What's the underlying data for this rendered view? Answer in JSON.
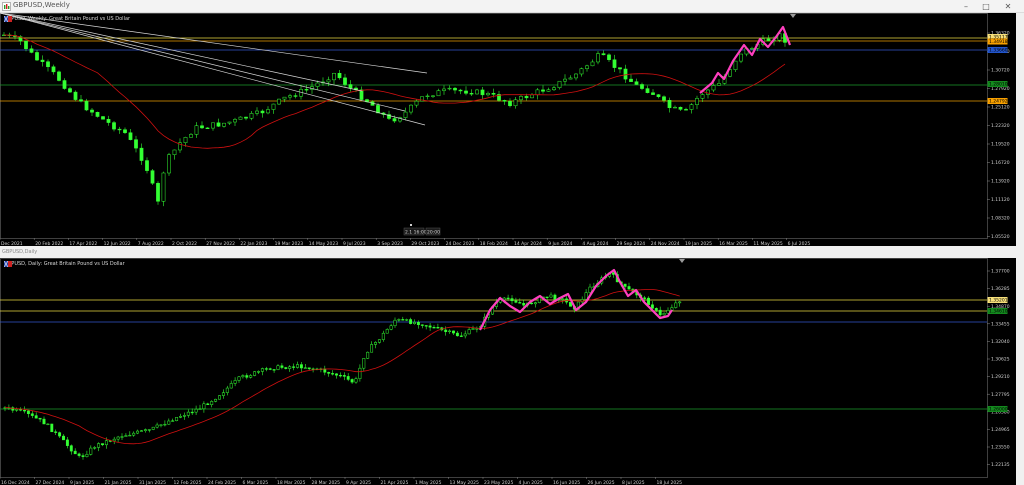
{
  "window": {
    "title": "GBPUSD,Weekly",
    "minimize": "–",
    "maximize": "□",
    "close": "✕"
  },
  "weekly": {
    "header": "GBPUSD, Weekly:  Great Britain Pound vs US Dollar",
    "price_labels": [
      "1.36320",
      "1.33570",
      "1.30720",
      "1.27920",
      "1.25120",
      "1.22320",
      "1.19520",
      "1.16720",
      "1.13920",
      "1.11120",
      "1.08320",
      "1.05520"
    ],
    "tags": [
      {
        "text": "1.35117",
        "color": "#f7e07a"
      },
      {
        "text": "1.34918",
        "color": "#f7a000"
      },
      {
        "text": "1.33660",
        "color": "#2255cc"
      },
      {
        "text": "1.28010",
        "color": "#138a1e"
      },
      {
        "text": "1.24792",
        "color": "#f7a000"
      }
    ],
    "time_labels": [
      "Dec 2021",
      "20 Feb 2022",
      "17 Apr 2022",
      "12 Jun 2022",
      "7 Aug 2022",
      "2 Oct 2022",
      "27 Nov 2022",
      "22 Jan 2023",
      "19 Mar 2023",
      "14 May 2023",
      "9 Jul 2023",
      "3 Sep 2023",
      "29 Oct 2023",
      "24 Dec 2023",
      "18 Feb 2024",
      "14 Apr 2024",
      "9 Jun 2024",
      "4 Aug 2024",
      "29 Sep 2024",
      "24 Nov 2024",
      "19 Jan 2025",
      "16 Mar 2025",
      "11 May 2025",
      "6 Jul 2025"
    ],
    "marker_labels": [
      "2.1 16:00",
      "20:00"
    ]
  },
  "daily": {
    "subwindow_title": "GBPUSD,Daily",
    "header": "GBPUSD, Daily:  Great Britain Pound vs US Dollar",
    "price_labels": [
      "1.37700",
      "1.36285",
      "1.34870",
      "1.33455",
      "1.32040",
      "1.30625",
      "1.29210",
      "1.27795",
      "1.26380",
      "1.24965",
      "1.23550",
      "1.22135"
    ],
    "tags": [
      {
        "text": "1.35201",
        "color": "#f7e07a"
      },
      {
        "text": "1.34610",
        "color": "#138a1e"
      },
      {
        "text": "1.26000",
        "color": "#138a1e"
      }
    ],
    "time_labels": [
      "16 Dec 2024",
      "27 Dec 2024",
      "9 Jan 2025",
      "21 Jan 2025",
      "31 Jan 2025",
      "12 Feb 2025",
      "24 Feb 2025",
      "6 Mar 2025",
      "18 Mar 2025",
      "28 Mar 2025",
      "9 Apr 2025",
      "21 Apr 2025",
      "1 May 2025",
      "13 May 2025",
      "23 May 2025",
      "4 Jun 2025",
      "16 Jun 2025",
      "26 Jun 2025",
      "8 Jul 2025",
      "18 Jul 2025"
    ]
  },
  "colors": {
    "background": "#000000",
    "bull": "#33ff33",
    "ma": "#d01010",
    "yellow_line": "#e8d840",
    "orange_line": "#e89a00",
    "green_line": "#1a9a2a",
    "blue_line": "#3355cc",
    "zigzag": "#ff3fbf",
    "trendline": "#d8d8d8"
  }
}
